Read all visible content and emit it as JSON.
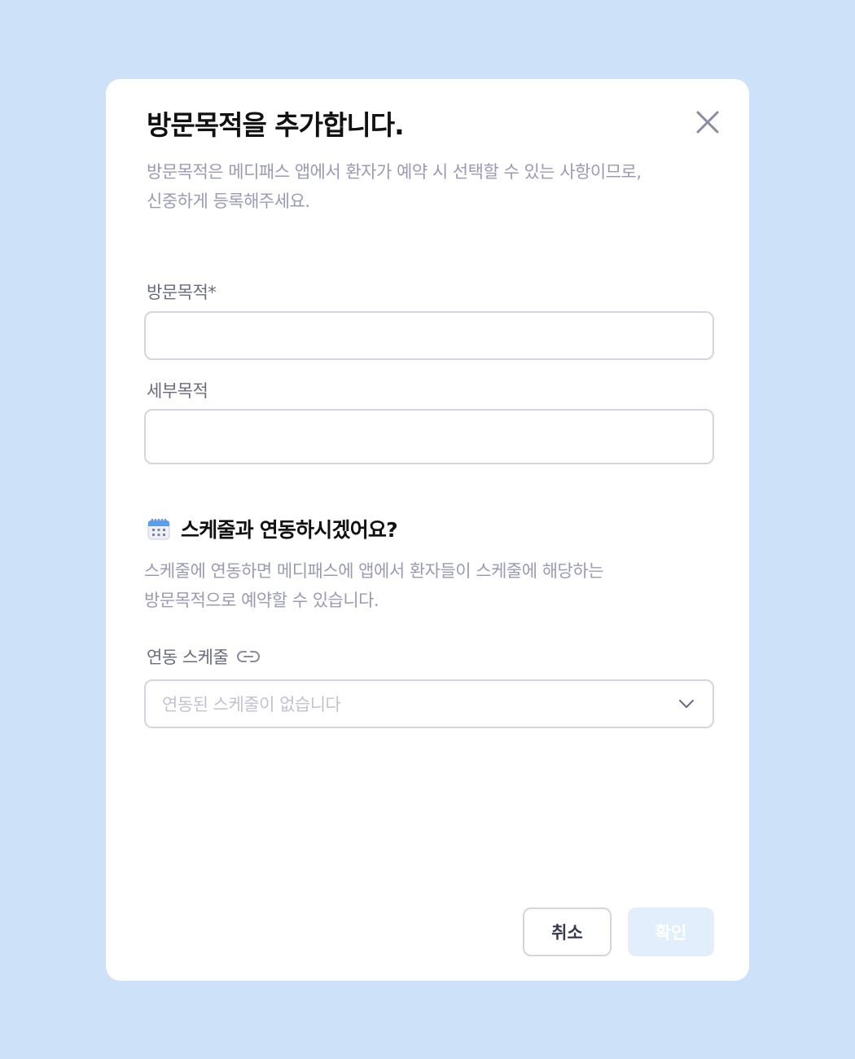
{
  "modal": {
    "title": "방문목적을 추가합니다.",
    "subtitle_line1": "방문목적은 메디패스 앱에서 환자가 예약 시 선택할 수 있는 사항이므로,",
    "subtitle_line2": "신중하게 등록해주세요.",
    "close_icon": "close-icon"
  },
  "form": {
    "purpose_label": "방문목적*",
    "purpose_value": "",
    "detail_label": "세부목적",
    "detail_value": ""
  },
  "schedule": {
    "section_icon": "calendar-icon",
    "section_title": "스케줄과 연동하시겠어요?",
    "desc_line1": "스케줄에 연동하면 메디패스에 앱에서 환자들이 스케줄에 해당하는",
    "desc_line2": "방문목적으로 예약할 수 있습니다.",
    "linked_label": "연동 스케줄",
    "link_icon": "link-icon",
    "select_placeholder": "연동된 스케줄이 없습니다",
    "chevron_icon": "chevron-down-icon"
  },
  "footer": {
    "cancel_label": "취소",
    "confirm_label": "확인"
  },
  "colors": {
    "background": "#cde2f9",
    "title": "#111111",
    "muted_text": "#9a9ab4",
    "label_text": "#6a6a80",
    "border": "#d5d5e0",
    "confirm_disabled_bg": "#e3eefc"
  }
}
